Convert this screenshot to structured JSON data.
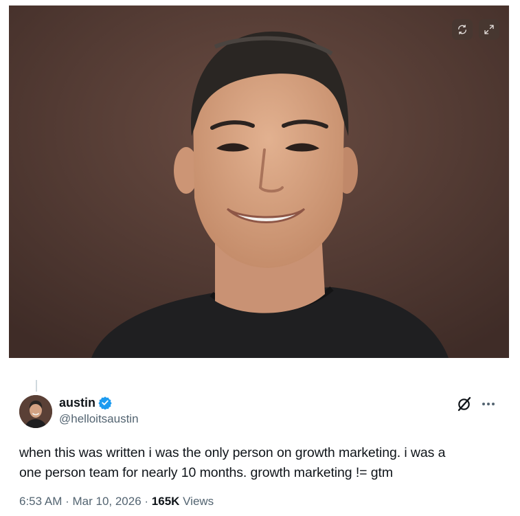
{
  "media": {
    "refresh_icon": "refresh-icon",
    "expand_icon": "expand-icon",
    "background_color": "#4e3730"
  },
  "author": {
    "display_name": "austin",
    "handle": "@helloitsaustin",
    "verified": true,
    "verified_color": "#1d9bf0",
    "avatar_icon": "avatar"
  },
  "actions": {
    "grok_icon": "grok-icon",
    "more_icon": "more-icon"
  },
  "tweet": {
    "line1": "when this was written i was the only person on growth marketing. i was a",
    "line2": "one person team for nearly 10 months. growth marketing != gtm"
  },
  "meta": {
    "time": "6:53 AM",
    "separator": " · ",
    "date": "Mar 10, 2026",
    "views_count": "165K",
    "views_label": " Views"
  }
}
